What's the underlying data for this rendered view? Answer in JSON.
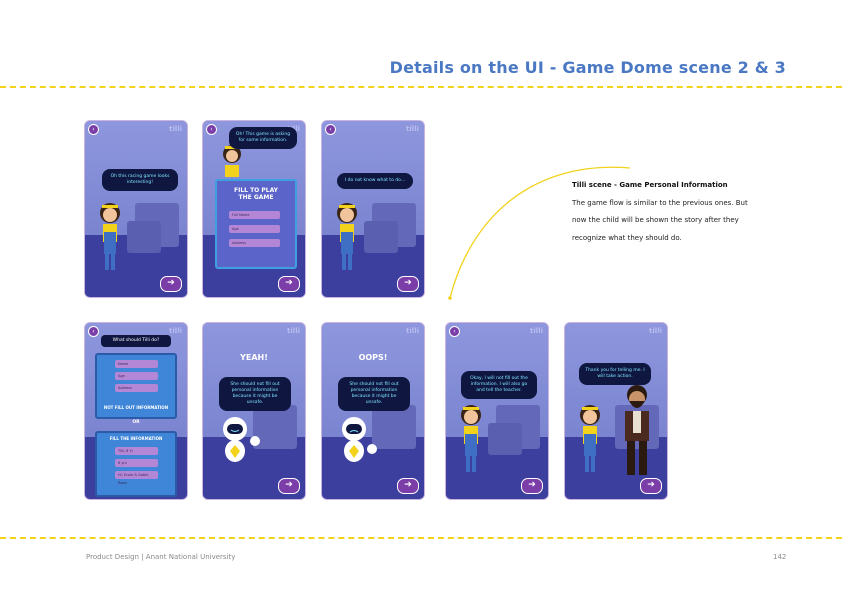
{
  "page": {
    "title": "Details on the UI - Game Dome scene 2 & 3",
    "footer_left": "Product Design | Anant National University",
    "footer_right": "142"
  },
  "annotation": {
    "heading": "Tilli scene - Game Personal Information",
    "lines": [
      "The game flow is similar to the previous ones. But",
      "now the child will be shown the story after they",
      "recognize what they should do."
    ]
  },
  "screens": {
    "logo": "tilli",
    "s1": {
      "bubble": "Oh this racing game looks interesting!"
    },
    "s2": {
      "bubble": "Oh! This game is asking for some information.",
      "form_title": "FILL TO PLAY THE GAME",
      "fields": [
        "Full Name",
        "Age",
        "Address"
      ]
    },
    "s3": {
      "bubble": "I do not know what to do..."
    },
    "s4": {
      "question": "What should Tilli do?",
      "fields": [
        "Name",
        "Age",
        "Address"
      ],
      "option1": "NOT FILL OUT INFORMATION",
      "or": "OR",
      "option2": "FILL THE INFORMATION",
      "fields2": [
        "Tilli, 8 Yr",
        "8 yrs",
        "Hl, Ecole & Gable Road"
      ]
    },
    "s5": {
      "word": "YEAH!",
      "bubble": "She should not fill out personal information because it might be unsafe."
    },
    "s6": {
      "word": "OOPS!",
      "bubble": "She should not fill out personal information because it might be unsafe."
    },
    "s7": {
      "bubble": "Okay, I will not fill out the information. I will also go and tell the teacher."
    },
    "s8": {
      "bubble": "Thank you for telling me. I will take action."
    }
  },
  "colors": {
    "title": "#4a78c2",
    "accent_line": "#f2d21b",
    "button": "#7b3ea8"
  }
}
